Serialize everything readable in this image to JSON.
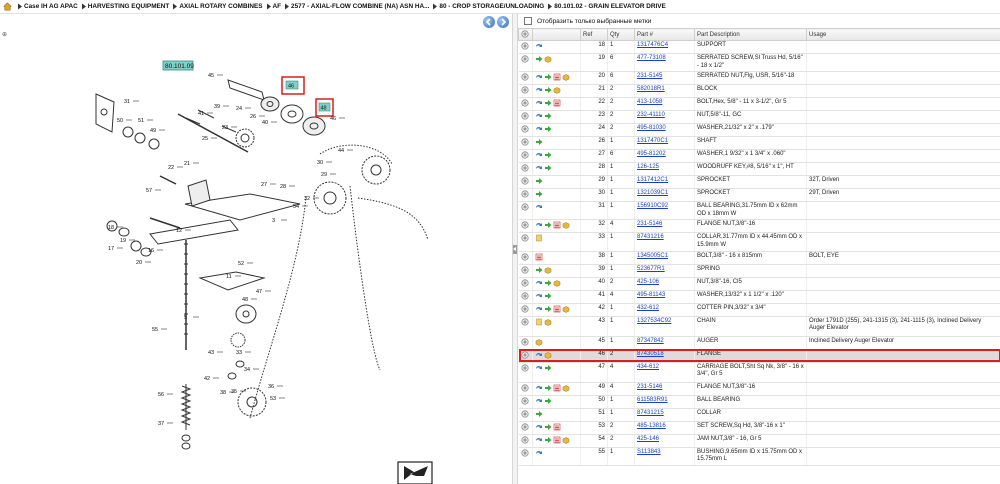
{
  "breadcrumb": [
    "Case IH AG APAC",
    "HARVESTING EQUIPMENT",
    "AXIAL ROTARY COMBINES",
    "AF",
    "2577 - AXIAL-FLOW COMBINE (NA) ASN HA...",
    "80 - CROP STORAGE/UNLOADING",
    "80.101.02 - GRAIN ELEVATOR DRIVE"
  ],
  "drawing": {
    "code": "80.101.09",
    "callouts": [
      "45",
      "31",
      "50",
      "51",
      "49",
      "46",
      "40",
      "39",
      "41",
      "25",
      "26",
      "24",
      "23",
      "22",
      "21",
      "29",
      "30",
      "32",
      "44",
      "54",
      "3",
      "28",
      "27",
      "57",
      "18",
      "17",
      "19",
      "20",
      "16",
      "12",
      "55",
      "5",
      "43",
      "42",
      "33",
      "34",
      "35",
      "56",
      "37",
      "38",
      "36",
      "53",
      "52",
      "48",
      "47",
      "11"
    ],
    "highlight_labels": [
      "46",
      "48"
    ]
  },
  "filter_label": "Отобразить только выбранные метки",
  "columns": [
    "Ref",
    "Qty",
    "Part #",
    "Part Description",
    "Usage"
  ],
  "rows": [
    {
      "ref": "18",
      "qty": "1",
      "part": "1317476C4",
      "desc": "SUPPORT",
      "usage": "",
      "icons": [
        "circle",
        "link"
      ]
    },
    {
      "ref": "19",
      "qty": "6",
      "part": "477-73108",
      "desc": "SERRATED SCREW,Sl Truss Hd, 5/16\" - 18 x 1/2\"",
      "usage": "",
      "icons": [
        "circle",
        "arrow",
        "box"
      ]
    },
    {
      "ref": "20",
      "qty": "6",
      "part": "231-5145",
      "desc": "SERRATED NUT,Flg, USR, 5/16\"-18",
      "usage": "",
      "icons": [
        "circle",
        "link",
        "arrow",
        "list",
        "box"
      ]
    },
    {
      "ref": "21",
      "qty": "2",
      "part": "582018R1",
      "desc": "BLOCK",
      "usage": "",
      "icons": [
        "circle",
        "link",
        "arrow",
        "box"
      ]
    },
    {
      "ref": "22",
      "qty": "2",
      "part": "413-1058",
      "desc": "BOLT,Hex, 5/8\" - 11 x 3-1/2\", Gr 5",
      "usage": "",
      "icons": [
        "circle",
        "link",
        "arrow",
        "list"
      ]
    },
    {
      "ref": "23",
      "qty": "2",
      "part": "232-41110",
      "desc": "NUT,5/8\"-11, GC",
      "usage": "",
      "icons": [
        "circle",
        "link",
        "arrow"
      ]
    },
    {
      "ref": "24",
      "qty": "2",
      "part": "495-81030",
      "desc": "WASHER,21/32\" x 2\" x .179\"",
      "usage": "",
      "icons": [
        "circle",
        "link",
        "arrow"
      ]
    },
    {
      "ref": "26",
      "qty": "1",
      "part": "1317470C1",
      "desc": "SHAFT",
      "usage": "",
      "icons": [
        "circle",
        "arrow"
      ]
    },
    {
      "ref": "27",
      "qty": "6",
      "part": "495-81202",
      "desc": "WASHER,1 9/32\" x 1 3/4\" x .060\"",
      "usage": "",
      "icons": [
        "circle",
        "link",
        "arrow"
      ]
    },
    {
      "ref": "28",
      "qty": "1",
      "part": "126-125",
      "desc": "WOODRUFF KEY,#8, 5/16\" x 1\", HT",
      "usage": "",
      "icons": [
        "circle",
        "link",
        "arrow"
      ]
    },
    {
      "ref": "29",
      "qty": "1",
      "part": "1317412C1",
      "desc": "SPROCKET",
      "usage": "32T, Driven",
      "icons": [
        "circle",
        "arrow"
      ]
    },
    {
      "ref": "30",
      "qty": "1",
      "part": "1321039C1",
      "desc": "SPROCKET",
      "usage": "29T, Driven",
      "icons": [
        "circle",
        "arrow"
      ]
    },
    {
      "ref": "31",
      "qty": "1",
      "part": "156910C92",
      "desc": "BALL BEARING,31.75mm ID x 62mm OD x 18mm W",
      "usage": "",
      "icons": [
        "circle",
        "link"
      ]
    },
    {
      "ref": "32",
      "qty": "4",
      "part": "231-5146",
      "desc": "FLANGE NUT,3/8\"-16",
      "usage": "",
      "icons": [
        "circle",
        "link",
        "arrow",
        "list",
        "box"
      ]
    },
    {
      "ref": "33",
      "qty": "1",
      "part": "87431216",
      "desc": "COLLAR,31.77mm ID x 44.45mm OD x 15.9mm W",
      "usage": "",
      "icons": [
        "circle",
        "doc"
      ]
    },
    {
      "ref": "38",
      "qty": "1",
      "part": "1345005C1",
      "desc": "BOLT,3/8\" - 16 x 815mm",
      "usage": "BOLT, EYE",
      "icons": [
        "circle",
        "list"
      ]
    },
    {
      "ref": "39",
      "qty": "1",
      "part": "523677R1",
      "desc": "SPRING",
      "usage": "",
      "icons": [
        "circle",
        "arrow",
        "box"
      ]
    },
    {
      "ref": "40",
      "qty": "2",
      "part": "425-106",
      "desc": "NUT,3/8\"-16, Cl5",
      "usage": "",
      "icons": [
        "circle",
        "link",
        "arrow",
        "box"
      ]
    },
    {
      "ref": "41",
      "qty": "4",
      "part": "495-81143",
      "desc": "WASHER,13/32\" x 1 1/2\" x .120\"",
      "usage": "",
      "icons": [
        "circle",
        "link",
        "arrow"
      ]
    },
    {
      "ref": "42",
      "qty": "1",
      "part": "432-612",
      "desc": "COTTER PIN,3/32\" x 3/4\"",
      "usage": "",
      "icons": [
        "circle",
        "link",
        "arrow",
        "list",
        "box"
      ]
    },
    {
      "ref": "43",
      "qty": "1",
      "part": "1327534C92",
      "desc": "CHAIN",
      "usage": "Order 1791D (255), 241-1315 (3), 241-1115 (3), Inclined Delivery Auger Elevator",
      "icons": [
        "circle",
        "doc",
        "box"
      ]
    },
    {
      "ref": "45",
      "qty": "1",
      "part": "87347842",
      "desc": "AUGER",
      "usage": "Inclined Delivery Auger Elevator",
      "icons": [
        "circle",
        "box"
      ]
    },
    {
      "ref": "46",
      "qty": "2",
      "part": "87430518",
      "desc": "FLANGE",
      "usage": "",
      "icons": [
        "circle",
        "link",
        "box"
      ],
      "selected": true
    },
    {
      "ref": "47",
      "qty": "4",
      "part": "434-612",
      "desc": "CARRIAGE BOLT,Sht Sq Nk, 3/8\" - 16 x 3/4\", Gr 5",
      "usage": "",
      "icons": [
        "circle",
        "link",
        "arrow"
      ]
    },
    {
      "ref": "49",
      "qty": "4",
      "part": "231-5146",
      "desc": "FLANGE NUT,3/8\"-16",
      "usage": "",
      "icons": [
        "circle",
        "link",
        "arrow",
        "list",
        "box"
      ]
    },
    {
      "ref": "50",
      "qty": "1",
      "part": "611583R91",
      "desc": "BALL BEARING",
      "usage": "",
      "icons": [
        "circle",
        "link",
        "arrow"
      ]
    },
    {
      "ref": "51",
      "qty": "1",
      "part": "87431215",
      "desc": "COLLAR",
      "usage": "",
      "icons": [
        "circle",
        "arrow"
      ]
    },
    {
      "ref": "53",
      "qty": "2",
      "part": "485-13816",
      "desc": "SET SCREW,Sq Hd, 3/8\"-16 x 1\"",
      "usage": "",
      "icons": [
        "circle",
        "link",
        "arrow",
        "list"
      ]
    },
    {
      "ref": "54",
      "qty": "2",
      "part": "425-146",
      "desc": "JAM NUT,3/8\" - 16, Gr 5",
      "usage": "",
      "icons": [
        "circle",
        "link",
        "arrow",
        "list",
        "box"
      ]
    },
    {
      "ref": "55",
      "qty": "1",
      "part": "S113843",
      "desc": "BUSHING,9.65mm ID x 15.75mm OD x 15.75mm L",
      "usage": "",
      "icons": [
        "circle",
        "link"
      ]
    }
  ],
  "colors": {
    "link": "#1a40c8",
    "highlight": "#d81e1e",
    "code_box": "#7fd0c8",
    "row_selected": "#dcdcdc"
  },
  "icon_names": {
    "circle": "add-circle-icon",
    "link": "link-icon",
    "arrow": "green-arrow-icon",
    "list": "list-icon",
    "box": "package-icon",
    "doc": "document-icon"
  }
}
